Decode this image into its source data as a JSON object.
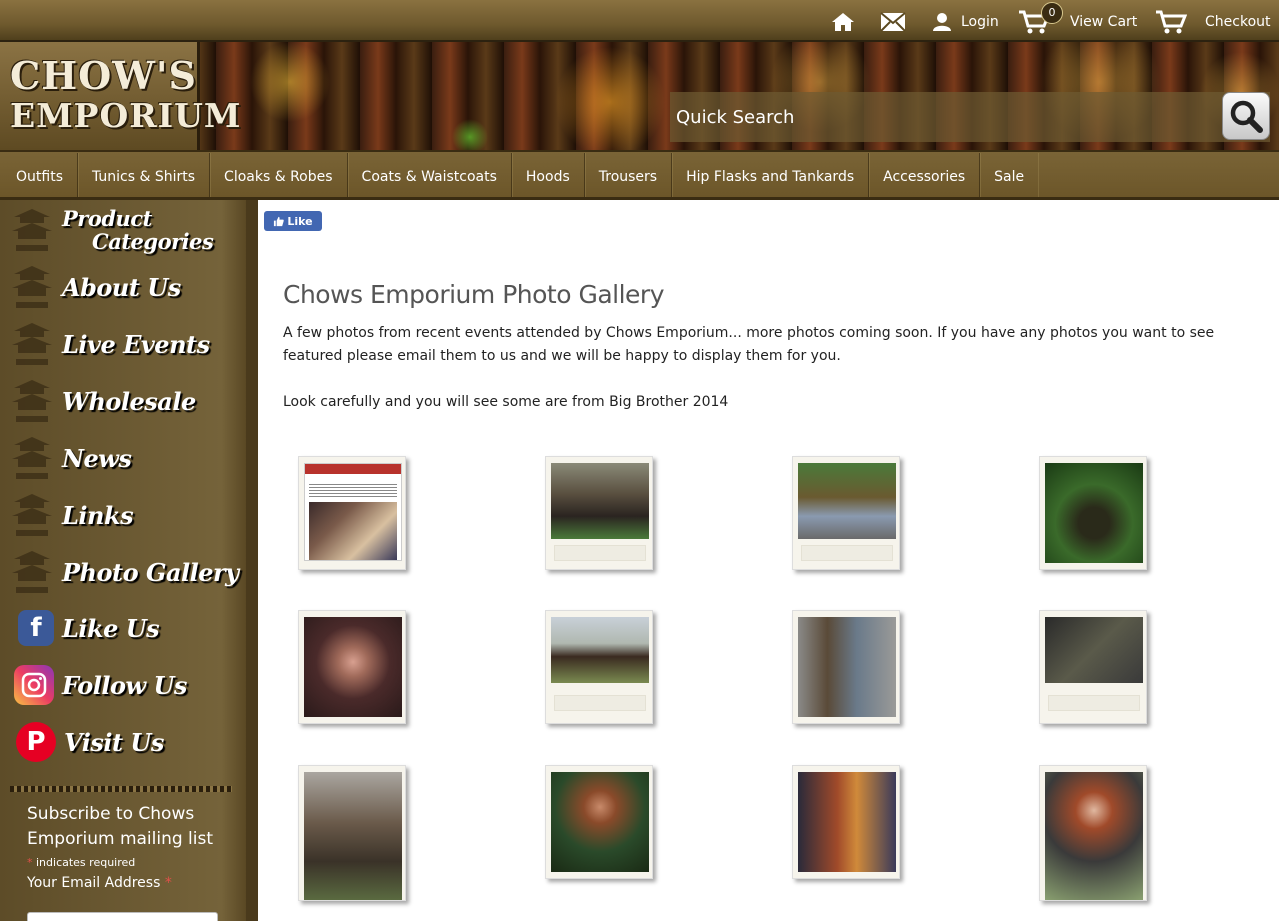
{
  "topbar": {
    "home_icon": "home-icon",
    "mail_icon": "envelope-icon",
    "login_label": "Login",
    "cart_count": "0",
    "view_cart_label": "View Cart",
    "checkout_label": "Checkout"
  },
  "banner": {
    "logo_line1": "CHOW'S",
    "logo_line2": "EMPORIUM",
    "search_placeholder": "Quick Search"
  },
  "nav": {
    "items": [
      "Outfits",
      "Tunics & Shirts",
      "Cloaks & Robes",
      "Coats & Waistcoats",
      "Hoods",
      "Trousers",
      "Hip Flasks and Tankards",
      "Accessories",
      "Sale"
    ]
  },
  "sidebar": {
    "items": [
      {
        "line1": "Product",
        "line2": "Categories"
      },
      {
        "label": "About Us"
      },
      {
        "label": "Live Events"
      },
      {
        "label": "Wholesale"
      },
      {
        "label": "News"
      },
      {
        "label": "Links"
      },
      {
        "label": "Photo Gallery"
      },
      {
        "label": "Like Us"
      },
      {
        "label": "Follow Us"
      },
      {
        "label": "Visit Us"
      }
    ],
    "subscribe": {
      "heading": "Subscribe to Chows Emporium mailing list",
      "required_note": "indicates required",
      "email_label": "Your Email Address"
    }
  },
  "main": {
    "fb_like": "Like",
    "title": "Chows Emporium Photo Gallery",
    "intro": "A few photos from recent events attended by Chows Emporium... more photos coming soon. If you have any photos you want to see featured please email them to us and we will be happy to display them for you.",
    "note": "Look carefully and you will see some are from Big Brother 2014"
  },
  "colors": {
    "sidebar_bg": "#6b5a35",
    "nav_bg": "#7a6436",
    "main_bg": "#ffffff",
    "fb_blue": "#4267b2",
    "required_star": "#e0504a"
  }
}
